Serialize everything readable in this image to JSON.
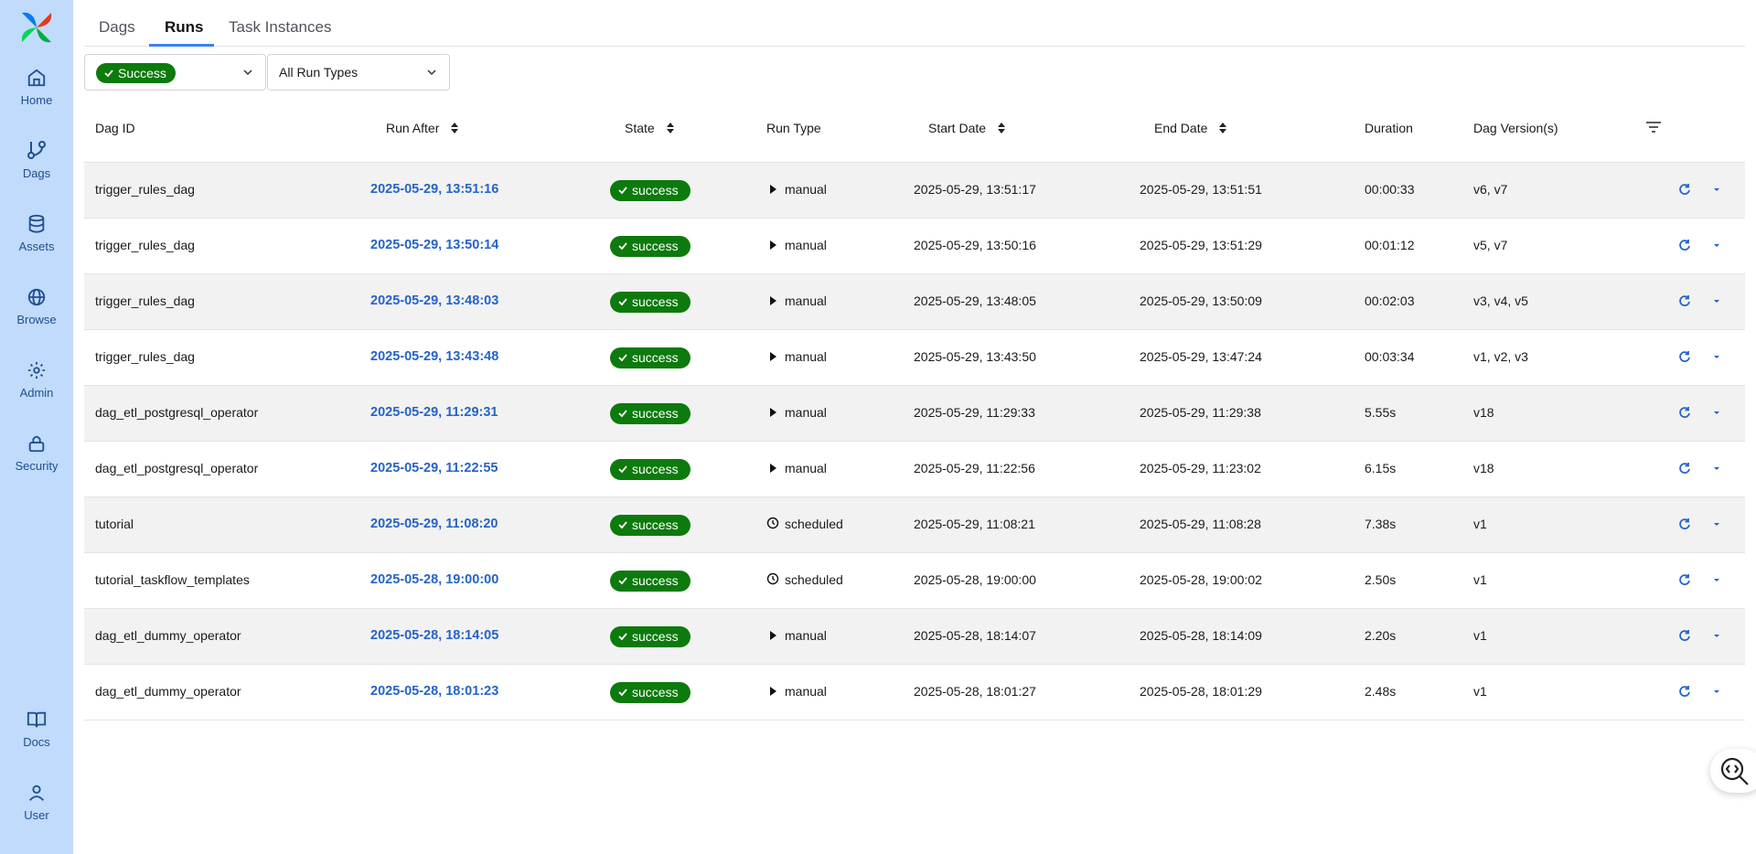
{
  "nav": {
    "home": "Home",
    "dags": "Dags",
    "assets": "Assets",
    "browse": "Browse",
    "admin": "Admin",
    "security": "Security",
    "docs": "Docs",
    "user": "User"
  },
  "tabs": {
    "dags": "Dags",
    "runs": "Runs",
    "task_instances": "Task Instances",
    "active": "Runs"
  },
  "filters": {
    "state_selected": "Success",
    "run_type_selected": "All Run Types"
  },
  "columns": {
    "dag_id": "Dag ID",
    "run_after": "Run After",
    "state": "State",
    "run_type": "Run Type",
    "start_date": "Start Date",
    "end_date": "End Date",
    "duration": "Duration",
    "dag_versions": "Dag Version(s)"
  },
  "rows": [
    {
      "dag_id": "trigger_rules_dag",
      "run_after": "2025-05-29, 13:51:16",
      "state": "success",
      "run_type": "manual",
      "start_date": "2025-05-29, 13:51:17",
      "end_date": "2025-05-29, 13:51:51",
      "duration": "00:00:33",
      "versions": "v6, v7"
    },
    {
      "dag_id": "trigger_rules_dag",
      "run_after": "2025-05-29, 13:50:14",
      "state": "success",
      "run_type": "manual",
      "start_date": "2025-05-29, 13:50:16",
      "end_date": "2025-05-29, 13:51:29",
      "duration": "00:01:12",
      "versions": "v5, v7"
    },
    {
      "dag_id": "trigger_rules_dag",
      "run_after": "2025-05-29, 13:48:03",
      "state": "success",
      "run_type": "manual",
      "start_date": "2025-05-29, 13:48:05",
      "end_date": "2025-05-29, 13:50:09",
      "duration": "00:02:03",
      "versions": "v3, v4, v5"
    },
    {
      "dag_id": "trigger_rules_dag",
      "run_after": "2025-05-29, 13:43:48",
      "state": "success",
      "run_type": "manual",
      "start_date": "2025-05-29, 13:43:50",
      "end_date": "2025-05-29, 13:47:24",
      "duration": "00:03:34",
      "versions": "v1, v2, v3"
    },
    {
      "dag_id": "dag_etl_postgresql_operator",
      "run_after": "2025-05-29, 11:29:31",
      "state": "success",
      "run_type": "manual",
      "start_date": "2025-05-29, 11:29:33",
      "end_date": "2025-05-29, 11:29:38",
      "duration": "5.55s",
      "versions": "v18"
    },
    {
      "dag_id": "dag_etl_postgresql_operator",
      "run_after": "2025-05-29, 11:22:55",
      "state": "success",
      "run_type": "manual",
      "start_date": "2025-05-29, 11:22:56",
      "end_date": "2025-05-29, 11:23:02",
      "duration": "6.15s",
      "versions": "v18"
    },
    {
      "dag_id": "tutorial",
      "run_after": "2025-05-29, 11:08:20",
      "state": "success",
      "run_type": "scheduled",
      "start_date": "2025-05-29, 11:08:21",
      "end_date": "2025-05-29, 11:08:28",
      "duration": "7.38s",
      "versions": "v1"
    },
    {
      "dag_id": "tutorial_taskflow_templates",
      "run_after": "2025-05-28, 19:00:00",
      "state": "success",
      "run_type": "scheduled",
      "start_date": "2025-05-28, 19:00:00",
      "end_date": "2025-05-28, 19:00:02",
      "duration": "2.50s",
      "versions": "v1"
    },
    {
      "dag_id": "dag_etl_dummy_operator",
      "run_after": "2025-05-28, 18:14:05",
      "state": "success",
      "run_type": "manual",
      "start_date": "2025-05-28, 18:14:07",
      "end_date": "2025-05-28, 18:14:09",
      "duration": "2.20s",
      "versions": "v1"
    },
    {
      "dag_id": "dag_etl_dummy_operator",
      "run_after": "2025-05-28, 18:01:23",
      "state": "success",
      "run_type": "manual",
      "start_date": "2025-05-28, 18:01:27",
      "end_date": "2025-05-28, 18:01:29",
      "duration": "2.48s",
      "versions": "v1"
    }
  ],
  "colors": {
    "sidebar_bg": "#c0dbfb",
    "success": "#0d7a0d",
    "link": "#2563c7",
    "tab_accent": "#3b82f6"
  },
  "icons": {
    "run_type_manual": "play-icon",
    "run_type_scheduled": "clock-icon",
    "row_actions": [
      "refresh-icon",
      "chevron-down-icon"
    ]
  }
}
